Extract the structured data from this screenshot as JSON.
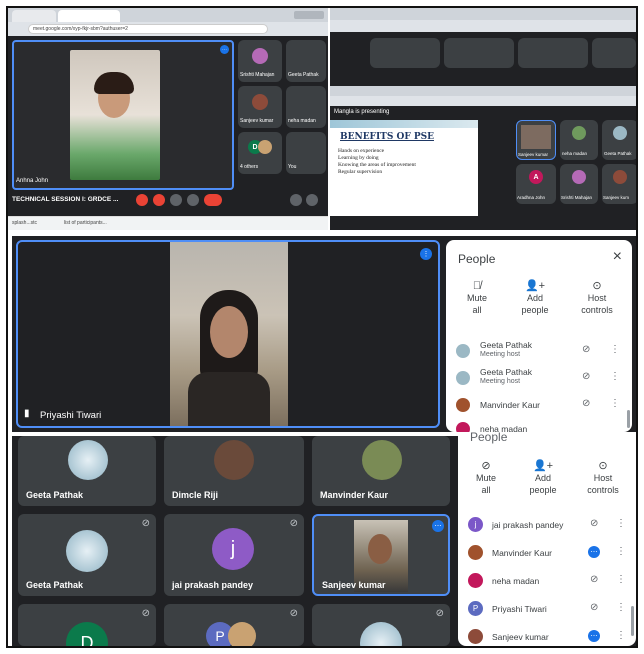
{
  "top_left": {
    "url": "meet.google.com/xyp-fkjr-sbm?authuser=2",
    "self_name": "Anhna John",
    "meeting_title": "TECHNICAL SESSION I: GRDCE ...",
    "participants": [
      "Srishti Mahajan",
      "Geeta Pathak",
      "Sanjeev kumar",
      "neha madan",
      "4 others",
      "You"
    ],
    "footer_left": "splash...stc",
    "footer_right": "list of participants...",
    "others_initial": "D"
  },
  "top_right": {
    "presenting_label": "Mangla is presenting",
    "slide_title": "BENEFITS OF PSE",
    "slide_bullets": [
      "Hands on experience",
      "Learning by doing",
      "Knowing the areas of improvement",
      "Regular supervision"
    ],
    "participants": [
      "Sanjeev kumar",
      "neha madan",
      "Geeta Pathak",
      "Aradhna John",
      "Srishti Mahajan",
      "Sanjeev kum"
    ],
    "aradhna_initial": "A"
  },
  "middle": {
    "speaker_name": "Priyashi Tiwari",
    "panel_title": "People",
    "close_icon": "×",
    "actions": [
      {
        "label": "Mute all",
        "icon": "mic-off-icon"
      },
      {
        "label": "Add people",
        "icon": "add-person-icon"
      },
      {
        "label": "Host controls",
        "icon": "toggle-icon"
      }
    ],
    "people": [
      {
        "name": "Geeta Pathak",
        "sub": "Meeting host"
      },
      {
        "name": "Geeta Pathak",
        "sub": "Meeting host"
      },
      {
        "name": "Manvinder Kaur",
        "sub": ""
      },
      {
        "name": "neha madan",
        "sub": ""
      }
    ]
  },
  "bottom": {
    "tiles": [
      "Geeta Pathak",
      "Dimcle Riji",
      "Manvinder Kaur",
      "Geeta Pathak",
      "jai prakash pandey",
      "Sanjeev kumar"
    ],
    "j_initial": "j",
    "d_initial": "D",
    "p_initial": "P",
    "panel_title": "People",
    "actions": [
      {
        "label": "Mute all"
      },
      {
        "label": "Add people"
      },
      {
        "label": "Host controls"
      }
    ],
    "people": [
      {
        "name": "jai prakash pandey",
        "initial": "j",
        "color": "#7b57c8"
      },
      {
        "name": "Manvinder Kaur",
        "initial": "",
        "color": "#a0522d"
      },
      {
        "name": "neha madan",
        "initial": "",
        "color": "#c2185b"
      },
      {
        "name": "Priyashi Tiwari",
        "initial": "P",
        "color": "#5c6bc0"
      },
      {
        "name": "Sanjeev kumar",
        "initial": "",
        "color": "#8d4b3a"
      }
    ]
  },
  "colors": {
    "meet_bg": "#202124",
    "tile_bg": "#3c4043",
    "accent_blue": "#1a73e8",
    "end_call_red": "#ea4335"
  }
}
